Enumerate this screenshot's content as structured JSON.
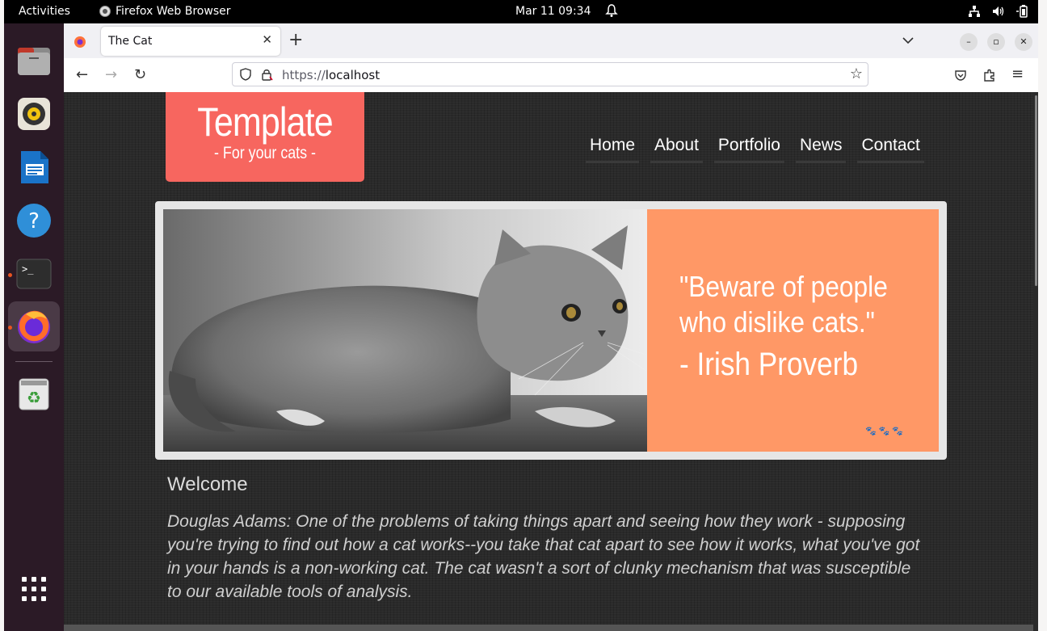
{
  "topbar": {
    "activities": "Activities",
    "app_name": "Firefox Web Browser",
    "clock": "Mar 11  09:34"
  },
  "dock": {
    "items": [
      "files-icon",
      "rhythmbox-icon",
      "writer-icon",
      "help-icon",
      "terminal-icon",
      "firefox-icon",
      "trash-icon",
      "app-grid-icon"
    ]
  },
  "browser": {
    "tab_title": "The Cat",
    "url_protocol": "https://",
    "url_host": "localhost"
  },
  "page": {
    "logo_title": "Template",
    "logo_subtitle": "- For your cats -",
    "menu": [
      "Home",
      "About",
      "Portfolio",
      "News",
      "Contact"
    ],
    "quote_text": "\"Beware of people who dislike cats.\"",
    "quote_author": "- Irish Proverb",
    "welcome_heading": "Welcome",
    "welcome_text": "Douglas Adams: One of the problems of taking things apart and seeing how they work - supposing you're trying to find out how a cat works--you take that cat apart to see how it works, what you've got in your hands is a non-working cat. The cat wasn't a sort of clunky mechanism that was susceptible to our available tools of analysis."
  },
  "colors": {
    "logo_bg": "#f7665f",
    "quote_bg": "#ff9866",
    "page_bg": "#2a2a2a"
  }
}
